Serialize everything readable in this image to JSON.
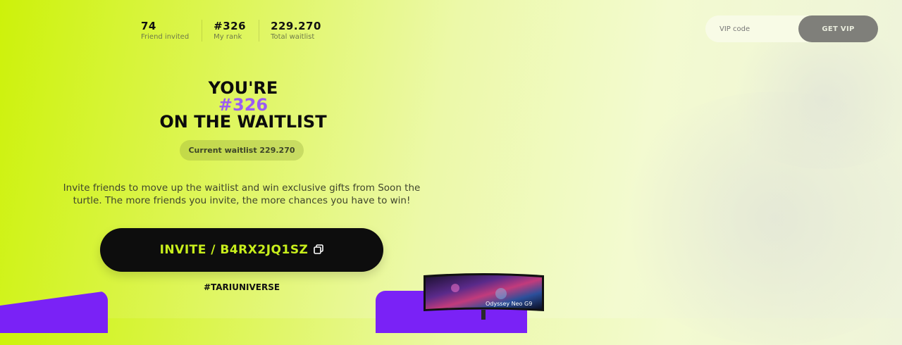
{
  "stats": [
    {
      "value": "74",
      "label": "Friend invited"
    },
    {
      "value": "#326",
      "label": "My rank"
    },
    {
      "value": "229.270",
      "label": "Total waitlist"
    }
  ],
  "vip": {
    "placeholder": "VIP code",
    "button_label": "GET VIP"
  },
  "headline": {
    "line1": "YOU'RE",
    "rank": "#326",
    "line3": "ON THE WAITLIST"
  },
  "current_waitlist": "Current waitlist 229.270",
  "description": "Invite friends to move up the waitlist and win exclusive gifts from Soon the turtle. The more friends you invite, the more chances you have to win!",
  "invite": {
    "label": "INVITE / B4RX2JQ1SZ",
    "icon": "copy-icon"
  },
  "hashtag": "#TARIUNIVERSE",
  "prize": {
    "monitor_text": "Odyssey Neo G9"
  },
  "colors": {
    "accent_lime": "#c8ee1c",
    "accent_purple": "#9b5cf3",
    "block_purple": "#7a22f6",
    "button_black": "#0d0d0d"
  }
}
